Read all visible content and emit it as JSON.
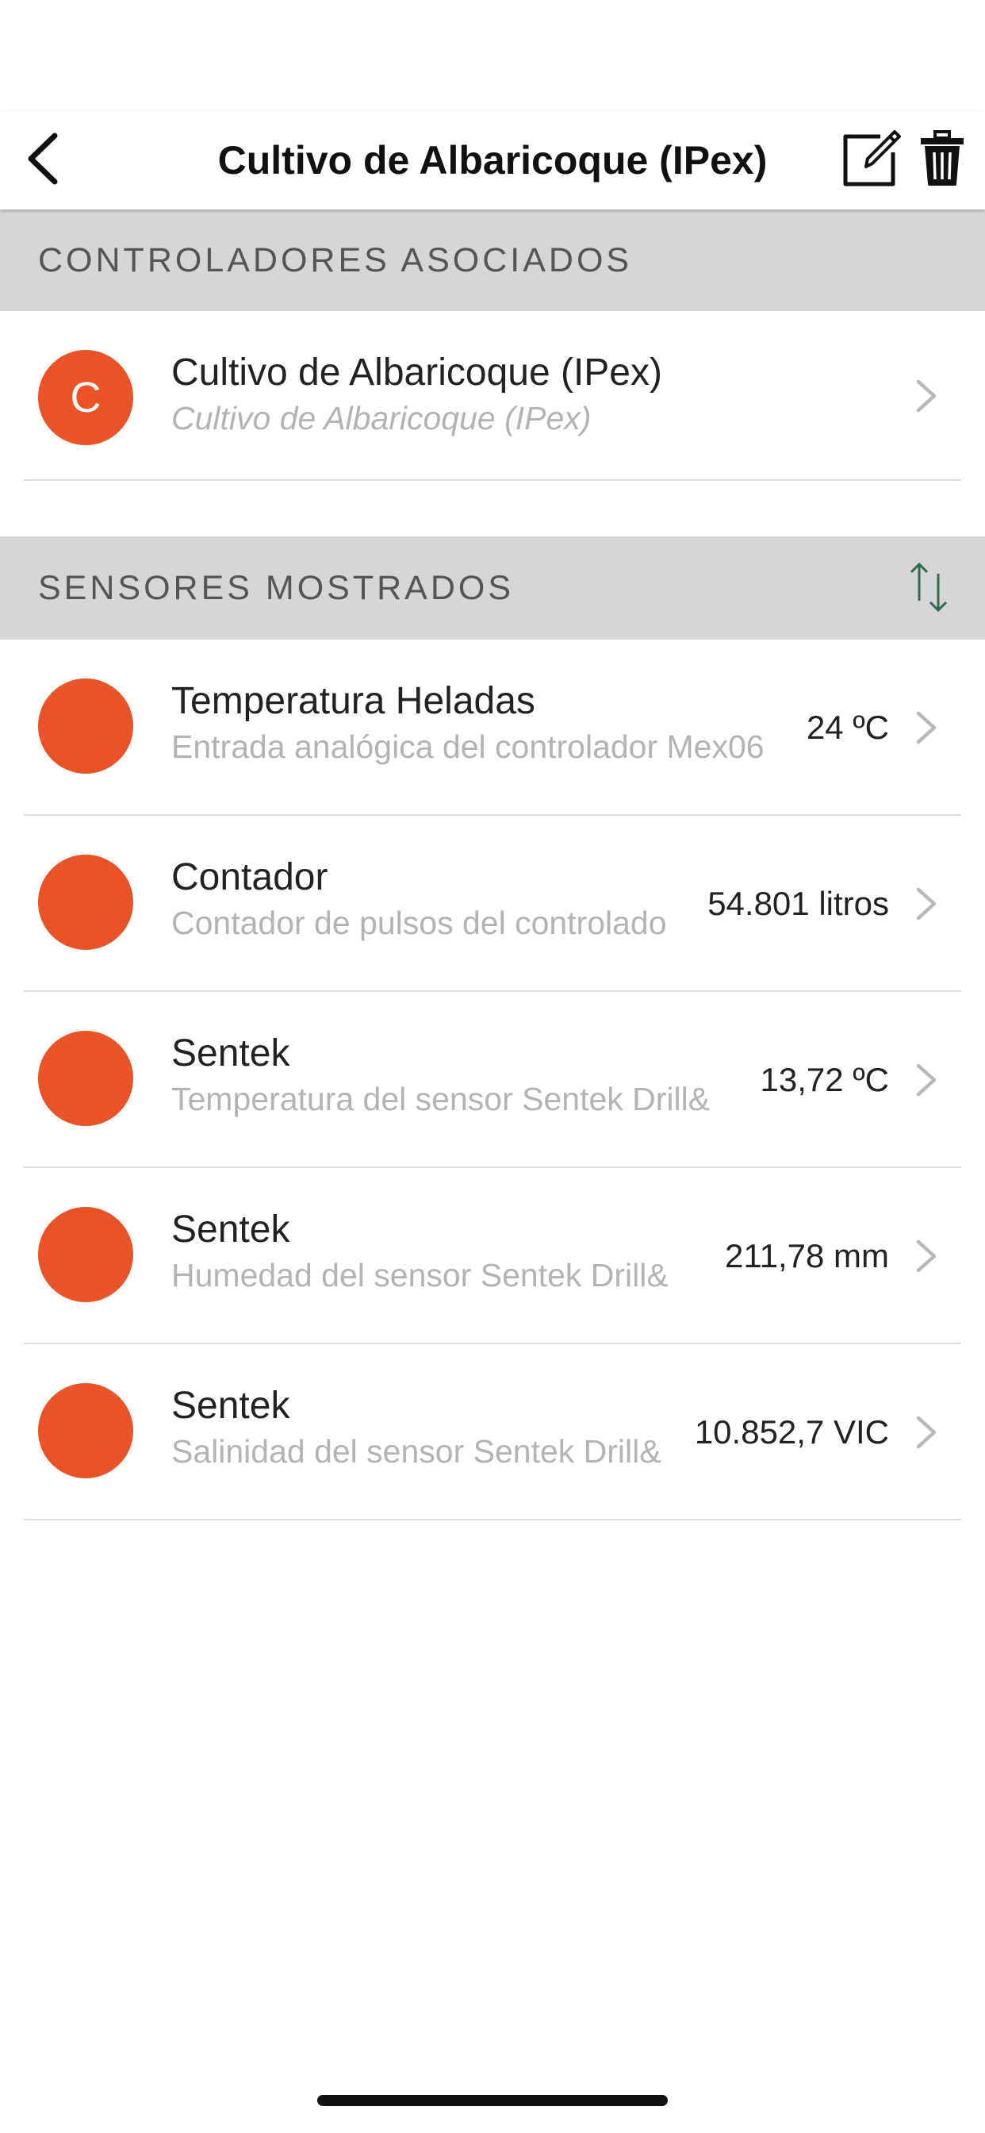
{
  "nav": {
    "title": "Cultivo de Albaricoque (IPex)",
    "back_icon": "chevron-left-icon",
    "edit_icon": "edit-icon",
    "delete_icon": "trash-icon"
  },
  "controllers_section": {
    "header": "CONTROLADORES ASOCIADOS",
    "items": [
      {
        "avatar_letter": "C",
        "title": "Cultivo de Albaricoque (IPex)",
        "subtitle": "Cultivo de Albaricoque (IPex)"
      }
    ]
  },
  "sensors_section": {
    "header": "SENSORES MOSTRADOS",
    "sort_icon": "sort-arrows-icon",
    "items": [
      {
        "title": "Temperatura Heladas",
        "subtitle": "Entrada analógica del controlador Mex06",
        "value": "24 ºC"
      },
      {
        "title": "Contador",
        "subtitle": "Contador de pulsos del controlador",
        "value": "54.801 litros"
      },
      {
        "title": "Sentek",
        "subtitle": "Temperatura del sensor Sentek Drill&",
        "value": "13,72 ºC"
      },
      {
        "title": "Sentek",
        "subtitle": "Humedad del sensor Sentek Drill&",
        "value": "211,78 mm"
      },
      {
        "title": "Sentek",
        "subtitle": "Salinidad del sensor Sentek Drill&",
        "value": "10.852,7 VIC"
      }
    ]
  },
  "colors": {
    "accent": "#e95325",
    "section_bg": "#d6d6d6",
    "sort_icon": "#2e6b4e"
  }
}
